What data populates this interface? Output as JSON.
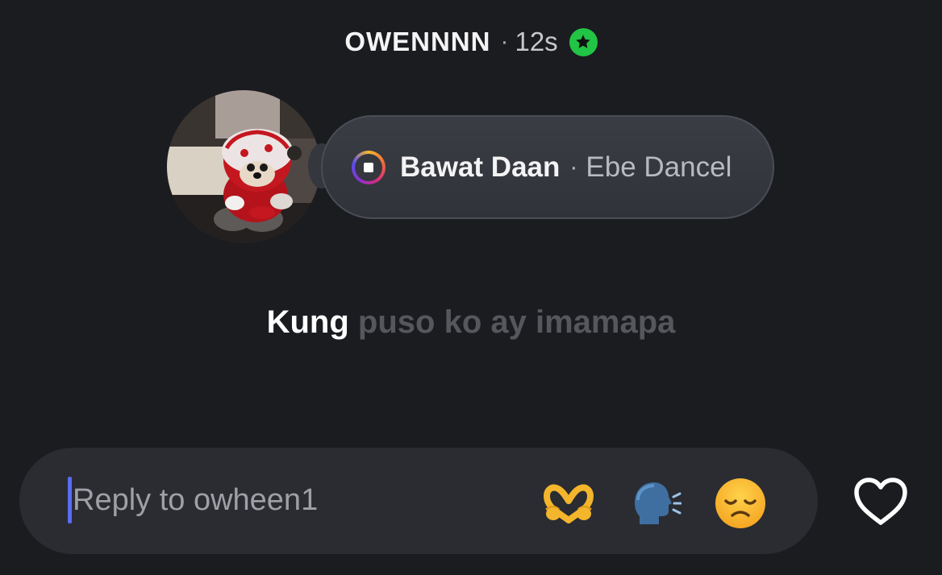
{
  "header": {
    "username": "OWENNNN",
    "separator": "·",
    "time": "12s",
    "close_friends_icon": "star-badge-icon",
    "badge_color": "#21c445"
  },
  "music": {
    "song_title": "Bawat Daan",
    "separator": "·",
    "artist": "Ebe Dancel",
    "icon": "music-stop-icon"
  },
  "lyrics": {
    "active": "Kung",
    "upcoming": "puso ko ay imamapa"
  },
  "reply": {
    "placeholder": "Reply to owheen1",
    "quick_reactions": [
      {
        "name": "heart-hands-emoji-icon",
        "label": "heart hands"
      },
      {
        "name": "speaking-head-emoji-icon",
        "label": "speaking head"
      },
      {
        "name": "disappointed-face-emoji-icon",
        "label": "disappointed face"
      }
    ],
    "like_icon": "heart-outline-icon"
  },
  "colors": {
    "background": "#1b1c20",
    "reply_bar": "#2a2c32",
    "caret": "#5a6bf5",
    "upcoming_lyric": "#55575d"
  }
}
